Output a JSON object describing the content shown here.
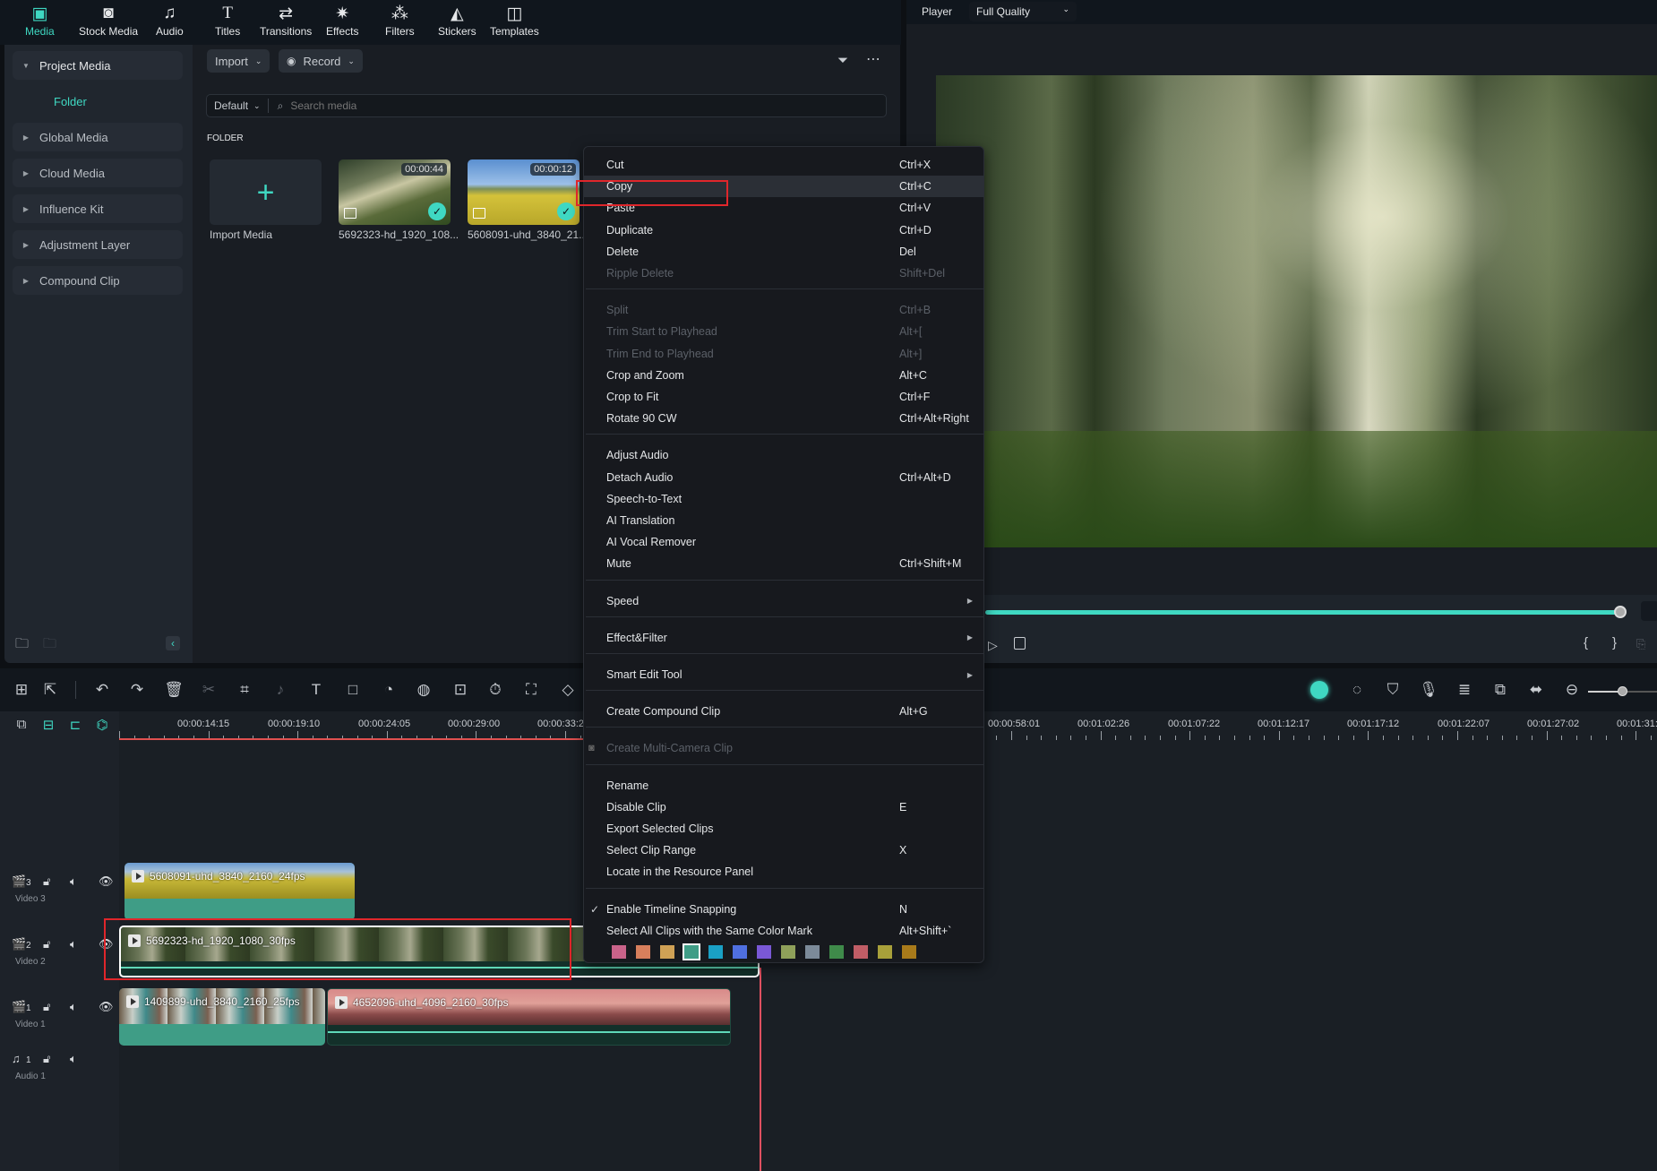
{
  "toolbar": {
    "items": [
      {
        "label": "Media",
        "icon": "media-icon",
        "active": true
      },
      {
        "label": "Stock Media",
        "icon": "stock-media-icon"
      },
      {
        "label": "Audio",
        "icon": "music-note-icon"
      },
      {
        "label": "Titles",
        "icon": "titles-icon"
      },
      {
        "label": "Transitions",
        "icon": "transitions-icon"
      },
      {
        "label": "Effects",
        "icon": "effects-icon"
      },
      {
        "label": "Filters",
        "icon": "filters-icon"
      },
      {
        "label": "Stickers",
        "icon": "stickers-icon"
      },
      {
        "label": "Templates",
        "icon": "templates-icon"
      }
    ]
  },
  "sidebar": {
    "items": [
      {
        "label": "Project Media",
        "expanded": true
      },
      {
        "label": "Global Media"
      },
      {
        "label": "Cloud Media"
      },
      {
        "label": "Influence Kit"
      },
      {
        "label": "Adjustment Layer"
      },
      {
        "label": "Compound Clip"
      }
    ],
    "folder_label": "Folder"
  },
  "media": {
    "import_label": "Import",
    "record_label": "Record",
    "sort_label": "Default",
    "search_placeholder": "Search media",
    "section_title": "FOLDER",
    "import_media_label": "Import Media",
    "items": [
      {
        "name": "5692323-hd_1920_108...",
        "duration": "00:00:44"
      },
      {
        "name": "5608091-uhd_3840_21...",
        "duration": "00:00:12"
      }
    ]
  },
  "player": {
    "label": "Player",
    "quality": "Full Quality",
    "progress": 0.99
  },
  "context_menu": {
    "groups": [
      [
        {
          "label": "Cut",
          "shortcut": "Ctrl+X"
        },
        {
          "label": "Copy",
          "shortcut": "Ctrl+C",
          "highlighted": true
        },
        {
          "label": "Paste",
          "shortcut": "Ctrl+V"
        },
        {
          "label": "Duplicate",
          "shortcut": "Ctrl+D"
        },
        {
          "label": "Delete",
          "shortcut": "Del"
        },
        {
          "label": "Ripple Delete",
          "shortcut": "Shift+Del",
          "disabled": true
        }
      ],
      [
        {
          "label": "Split",
          "shortcut": "Ctrl+B",
          "disabled": true
        },
        {
          "label": "Trim Start to Playhead",
          "shortcut": "Alt+[",
          "disabled": true
        },
        {
          "label": "Trim End to Playhead",
          "shortcut": "Alt+]",
          "disabled": true
        },
        {
          "label": "Crop and Zoom",
          "shortcut": "Alt+C"
        },
        {
          "label": "Crop to Fit",
          "shortcut": "Ctrl+F"
        },
        {
          "label": "Rotate 90 CW",
          "shortcut": "Ctrl+Alt+Right"
        }
      ],
      [
        {
          "label": "Adjust Audio",
          "shortcut": ""
        },
        {
          "label": "Detach Audio",
          "shortcut": "Ctrl+Alt+D"
        },
        {
          "label": "Speech-to-Text",
          "shortcut": ""
        },
        {
          "label": "AI Translation",
          "shortcut": ""
        },
        {
          "label": "AI Vocal Remover",
          "shortcut": ""
        },
        {
          "label": "Mute",
          "shortcut": "Ctrl+Shift+M"
        }
      ],
      [
        {
          "label": "Speed",
          "submenu": true
        }
      ],
      [
        {
          "label": "Effect&Filter",
          "submenu": true
        }
      ],
      [
        {
          "label": "Smart Edit Tool",
          "submenu": true
        }
      ],
      [
        {
          "label": "Create Compound Clip",
          "shortcut": "Alt+G"
        }
      ],
      [
        {
          "label": "Create Multi-Camera Clip",
          "disabled": true
        }
      ],
      [
        {
          "label": "Rename",
          "shortcut": ""
        },
        {
          "label": "Disable Clip",
          "shortcut": "E"
        },
        {
          "label": "Export Selected Clips",
          "shortcut": ""
        },
        {
          "label": "Select Clip Range",
          "shortcut": "X"
        },
        {
          "label": "Locate in the Resource Panel",
          "shortcut": ""
        }
      ],
      [
        {
          "label": "Enable Timeline Snapping",
          "shortcut": "N",
          "checked": true
        },
        {
          "label": "Select All Clips with the Same Color Mark",
          "shortcut": "Alt+Shift+`"
        }
      ]
    ],
    "color_marks": [
      "#c9638a",
      "#d77f5c",
      "#cfa155",
      "#3f9d86",
      "#1aa0c5",
      "#4f6fe0",
      "#7a58d6",
      "#8fa05a",
      "#7c8a99",
      "#3f8a4a",
      "#c05d66",
      "#a8a03a",
      "#a87a1a"
    ],
    "selected_color_index": 3
  },
  "timeline": {
    "ruler_left": [
      "00:00:14:15",
      "00:00:19:10",
      "00:00:24:05",
      "00:00:29:00",
      "00:00:33:2"
    ],
    "ruler_right": [
      "00:00:58:01",
      "00:01:02:26",
      "00:01:07:22",
      "00:01:12:17",
      "00:01:17:12",
      "00:01:22:07",
      "00:01:27:02",
      "00:01:31:"
    ],
    "tracks": [
      {
        "name": "Video 3",
        "num": "3",
        "type": "video"
      },
      {
        "name": "Video 2",
        "num": "2",
        "type": "video"
      },
      {
        "name": "Video 1",
        "num": "1",
        "type": "video"
      },
      {
        "name": "Audio 1",
        "num": "1",
        "type": "audio"
      }
    ],
    "clips": {
      "v3": "5608091-uhd_3840_2160_24fps",
      "v2": "5692323-hd_1920_1080_30fps",
      "v1a": "1409899-uhd_3840_2160_25fps",
      "v1b": "4652096-uhd_4096_2160_30fps"
    },
    "zoom_level": 0.5
  }
}
